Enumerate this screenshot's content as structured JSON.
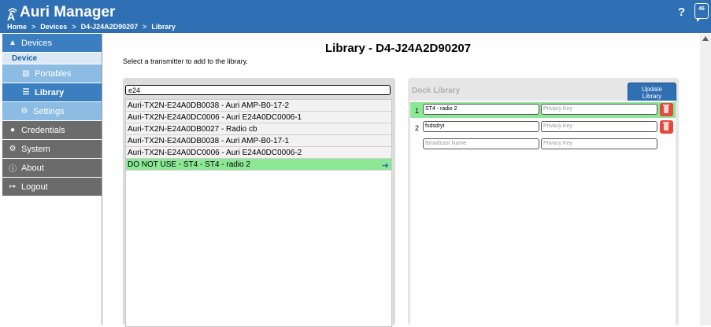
{
  "header": {
    "app_title": "Auri Manager",
    "breadcrumb": [
      "Home",
      "Devices",
      "D4-J24A2D90207",
      "Library"
    ],
    "breadcrumb_sep": ">",
    "help_label": "?",
    "notification_count": "46"
  },
  "sidebar": {
    "devices": "Devices",
    "device_header": "Device",
    "portables": "Portables",
    "library": "Library",
    "settings": "Settings",
    "credentials": "Credentials",
    "system": "System",
    "about": "About",
    "logout": "Logout"
  },
  "main": {
    "title": "Library - D4-J24A2D90207",
    "instruction": "Select a transmitter to add to the library.",
    "search_value": "e24",
    "transmitters": [
      "Auri-TX2N-E24A0DB0038 - Auri AMP-B0-17-2",
      "Auri-TX2N-E24A0DC0006 - Auri E24A0DC0006-1",
      "Auri-TX2N-E24A0DB0027 - Radio cb",
      "Auri-TX2N-E24A0DB0038 - Auri AMP-B0-17-1",
      "Auri-TX2N-E24A0DC0006 - Auri E24A0DC0006-2",
      "DO NOT USE - ST4 - ST4 - radio 2"
    ]
  },
  "dock": {
    "title": "Dock Library",
    "update_label_1": "Update",
    "update_label_2": "Library",
    "rows": [
      {
        "num": "1",
        "name": "ST4 - radio 2",
        "key_placeholder": "Privacy Key"
      },
      {
        "num": "2",
        "name": "fsdsdryt",
        "key_placeholder": "Privacy Key"
      },
      {
        "num": "",
        "name_placeholder": "Broadcast Name",
        "key_placeholder": "Privacy Key"
      }
    ]
  },
  "colors": {
    "header_blue": "#2f6fb3",
    "selected_green": "#8de896",
    "trash_red": "#e24a3e"
  }
}
